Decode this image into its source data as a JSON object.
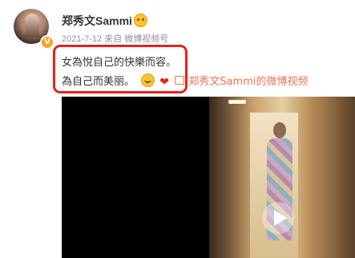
{
  "post": {
    "author_name": "郑秀文Sammi",
    "meta_text": "2021-7-12 来自 微博视频号",
    "text_line1": "女為悅自己的快樂而容。",
    "text_line2": "為自己而美丽。",
    "video_link": "郑秀文Sammi的微博视频"
  },
  "icons": {
    "verified": "verified-badge",
    "member": "smiley-face-icon",
    "emoji1": "smile-emoji",
    "emoji2": "heart-emoji",
    "video": "video-link-icon",
    "play": "play-icon"
  },
  "colors": {
    "highlight": "#e8201e",
    "link": "#eb7350",
    "verified": "#f5a623"
  }
}
